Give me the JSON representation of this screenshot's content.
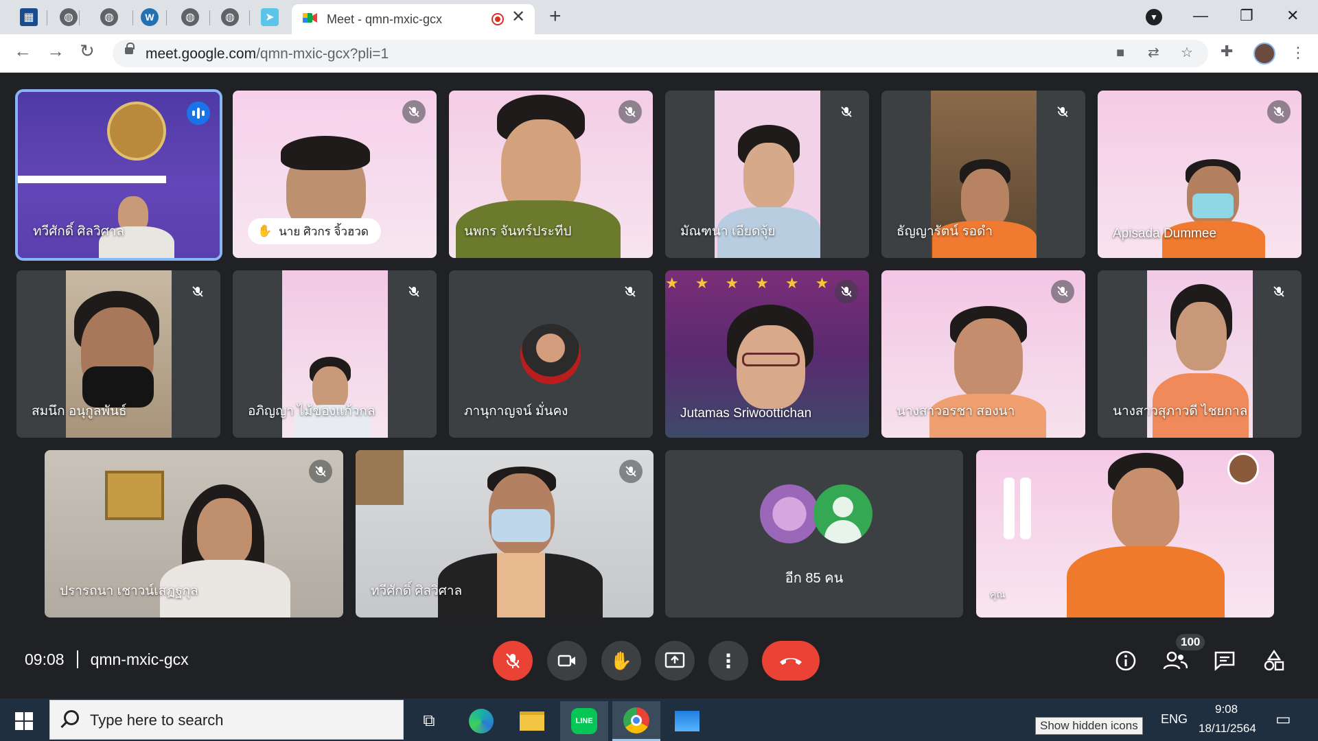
{
  "browser": {
    "active_tab_title": "Meet - qmn-mxic-gcx",
    "new_tab_symbol": "+",
    "close_tab_symbol": "✕",
    "url_main": "meet.google.com",
    "url_path": "/qmn-mxic-gcx?pli=1",
    "window_controls": [
      "—",
      "❐",
      "✕"
    ],
    "tab_icons": [
      "calendar-icon",
      "globe-icon",
      "globe-icon",
      "wordpress-icon",
      "globe-icon",
      "globe-icon",
      "bird-icon"
    ]
  },
  "participants": [
    {
      "name": "ทวีศักดิ์ ศิลวิศาล",
      "muted": false,
      "speaking": true
    },
    {
      "name": "นาย ศิวกร จิ้วฮวด",
      "muted": true,
      "hand_raised": true
    },
    {
      "name": "นพกร จันทร์ประทีป",
      "muted": true
    },
    {
      "name": "มัณฑนา เอียดจุ้ย",
      "muted": true
    },
    {
      "name": "ธัญญารัตน์ รอดำ",
      "muted": true
    },
    {
      "name": "Apisada Dummee",
      "muted": true
    },
    {
      "name": "สมนึก อนุกูลพันธ์",
      "muted": true
    },
    {
      "name": "อภิญญา ไม้ของแก้วกล",
      "muted": true
    },
    {
      "name": "ภานุกาญจน์ มั่นคง",
      "muted": true
    },
    {
      "name": "Jutamas Sriwoottichan",
      "muted": true
    },
    {
      "name": "นางสาวอรชา สองนา",
      "muted": true
    },
    {
      "name": "นางสาวสุภาวดี ไชยกาล",
      "muted": true
    },
    {
      "name": "ปรารถนา เชาวน์เสฏฐกุล",
      "muted": true
    },
    {
      "name": "ทวีศักดิ์ ศิลวิศาล",
      "muted": true
    },
    {
      "name": "คุณ",
      "muted": true
    }
  ],
  "others_tile": {
    "label": "อีก 85 คน"
  },
  "meeting": {
    "time": "09:08",
    "code": "qmn-mxic-gcx",
    "participants_count": "100"
  },
  "taskbar": {
    "search_placeholder": "Type here to search",
    "tooltip": "Show hidden icons",
    "lang": "ENG",
    "clock_time": "9:08",
    "clock_date": "18/11/2564"
  },
  "colors": {
    "meet_bg": "#202124",
    "tile_bg": "#3c4043",
    "end_call": "#ea4335",
    "accent": "#8ab4f8",
    "banner_pink": "#f3c6e8"
  }
}
